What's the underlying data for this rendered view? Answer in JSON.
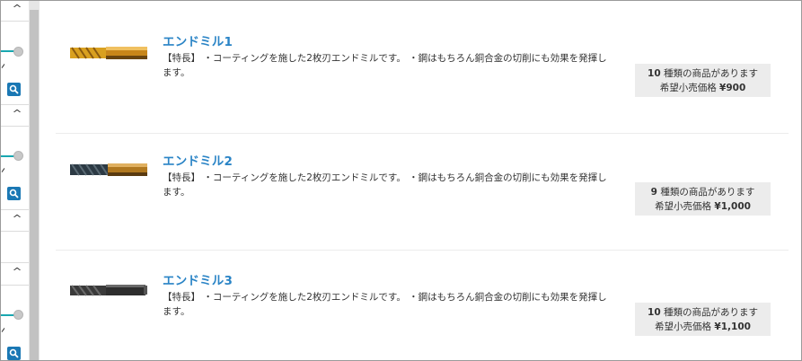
{
  "filters": {
    "search_icon": "search-icon",
    "caret_icon": "chevron-up-icon",
    "accent_color": "#19a7b0",
    "search_button_color": "#1a78b4"
  },
  "products": [
    {
      "name": "エンドミル1",
      "description": "【特長】 ・コーティングを施した2枚刃エンドミルです。 ・鋼はもちろん銅合金の切削にも効果を発揮します。",
      "count": "10",
      "count_suffix": " 種類の商品があります",
      "price_label": "希望小売価格 ",
      "price": "¥900",
      "image": "gold-end-mill"
    },
    {
      "name": "エンドミル2",
      "description": "【特長】 ・コーティングを施した2枚刃エンドミルです。 ・鋼はもちろん銅合金の切削にも効果を発揮します。",
      "count": "9",
      "count_suffix": " 種類の商品があります",
      "price_label": "希望小売価格 ",
      "price": "¥1,000",
      "image": "dark-gold-end-mill"
    },
    {
      "name": "エンドミル3",
      "description": "【特長】 ・コーティングを施した2枚刃エンドミルです。 ・鋼はもちろん銅合金の切削にも効果を発揮します。",
      "count": "10",
      "count_suffix": " 種類の商品があります",
      "price_label": "希望小売価格 ",
      "price": "¥1,100",
      "image": "black-end-mill"
    }
  ]
}
